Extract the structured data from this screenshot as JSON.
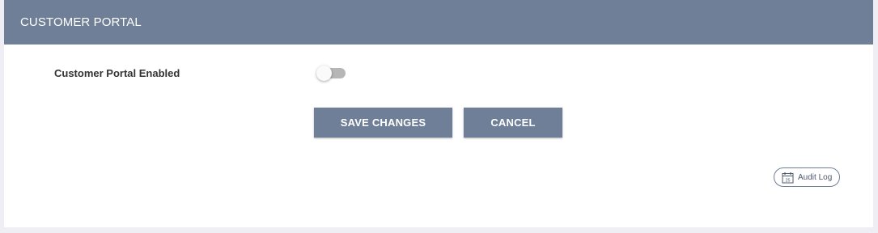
{
  "panel": {
    "title": "CUSTOMER PORTAL"
  },
  "settings": {
    "customer_portal_enabled": {
      "label": "Customer Portal Enabled",
      "value": false
    }
  },
  "actions": {
    "save_label": "SAVE CHANGES",
    "cancel_label": "CANCEL"
  },
  "audit_log": {
    "label": "Audit Log",
    "icon": "calendar-icon",
    "icon_day": "25"
  },
  "colors": {
    "header_bg": "#6f7f97",
    "button_bg": "#6f7f97",
    "toggle_off_track": "#b6b6b6"
  }
}
